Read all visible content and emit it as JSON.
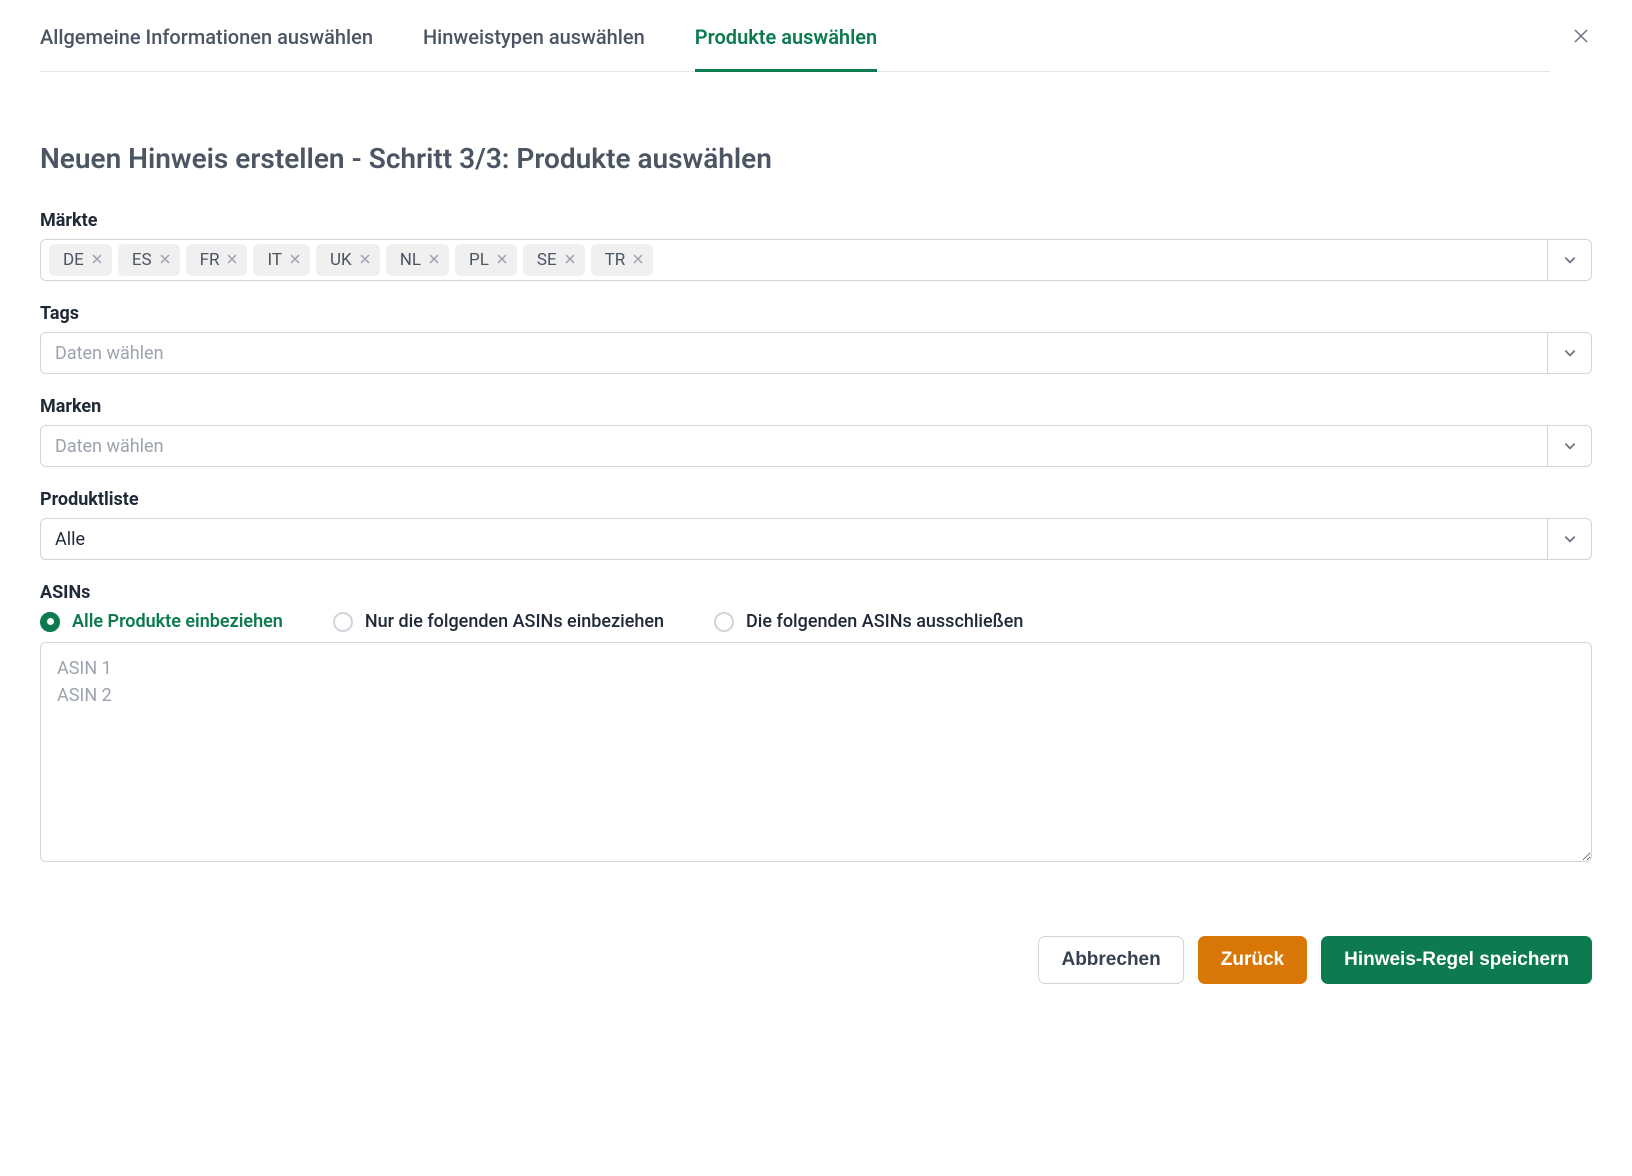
{
  "tabs": {
    "general": "Allgemeine Informationen auswählen",
    "types": "Hinweistypen auswählen",
    "products": "Produkte auswählen"
  },
  "page_title": "Neuen Hinweis erstellen - Schritt 3/3: Produkte auswählen",
  "markets": {
    "label": "Märkte",
    "values": [
      "DE",
      "ES",
      "FR",
      "IT",
      "UK",
      "NL",
      "PL",
      "SE",
      "TR"
    ]
  },
  "tags": {
    "label": "Tags",
    "placeholder": "Daten wählen"
  },
  "brands": {
    "label": "Marken",
    "placeholder": "Daten wählen"
  },
  "product_list": {
    "label": "Produktliste",
    "value": "Alle"
  },
  "asins": {
    "label": "ASINs",
    "option_all": "Alle Produkte einbeziehen",
    "option_include": "Nur die folgenden ASINs einbeziehen",
    "option_exclude": "Die folgenden ASINs ausschließen",
    "textarea_placeholder": "ASIN 1\nASIN 2"
  },
  "buttons": {
    "cancel": "Abbrechen",
    "back": "Zurück",
    "save": "Hinweis-Regel speichern"
  }
}
